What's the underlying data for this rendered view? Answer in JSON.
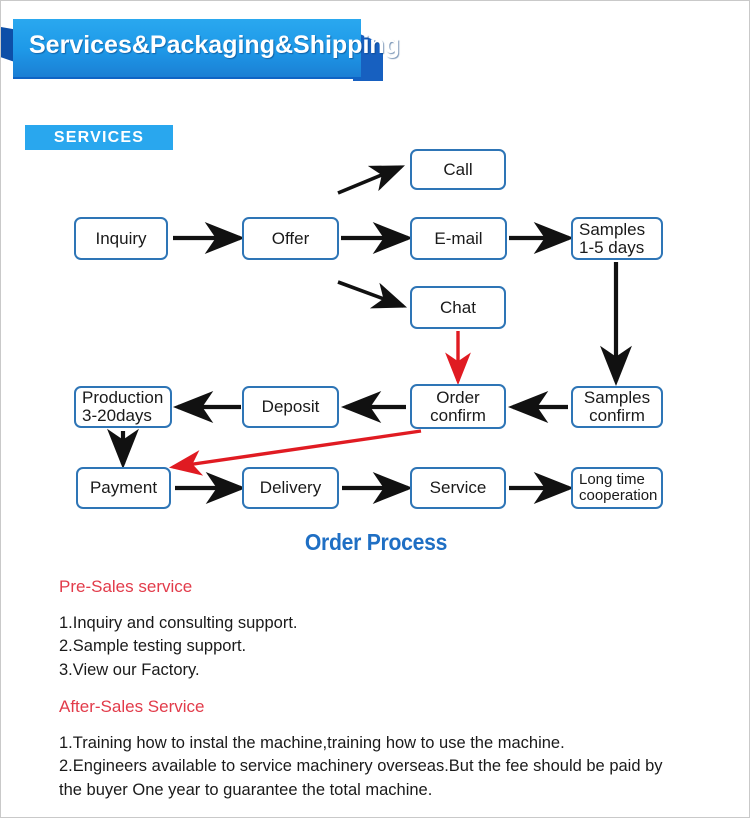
{
  "banner": {
    "title": "Services&Packaging&Shipping",
    "colors": {
      "light": "#29a7ee",
      "mid": "#1e99e8",
      "dark": "#1760c0",
      "fold": "#0d4fa8"
    }
  },
  "services_tag": {
    "label": "SERVICES",
    "bg": "#29a7ee",
    "text_color": "#ffffff"
  },
  "diagram": {
    "caption": "Order Process",
    "caption_color": "#1f6fc4",
    "node_border_color": "#2e75b6",
    "arrow_colors": {
      "black": "#111111",
      "red": "#e01b22"
    },
    "nodes": [
      {
        "id": "inquiry",
        "label": "Inquiry"
      },
      {
        "id": "offer",
        "label": "Offer"
      },
      {
        "id": "call",
        "label": "Call"
      },
      {
        "id": "email",
        "label": "E-mail"
      },
      {
        "id": "chat",
        "label": "Chat"
      },
      {
        "id": "samples_days",
        "label": "Samples\n1-5 days"
      },
      {
        "id": "samples_confirm",
        "label": "Samples\nconfirm"
      },
      {
        "id": "order_confirm",
        "label": "Order\nconfirm"
      },
      {
        "id": "deposit",
        "label": "Deposit"
      },
      {
        "id": "production",
        "label": "Production\n3-20days"
      },
      {
        "id": "payment",
        "label": "Payment"
      },
      {
        "id": "delivery",
        "label": "Delivery"
      },
      {
        "id": "service",
        "label": "Service"
      },
      {
        "id": "long_time",
        "label": "Long time\ncooperation"
      }
    ]
  },
  "pre_sales": {
    "heading": "Pre-Sales service",
    "heading_color": "#e23b4a",
    "body": "1.Inquiry and consulting support.\n2.Sample testing support.\n3.View our Factory."
  },
  "after_sales": {
    "heading": "After-Sales Service",
    "heading_color": "#e23b4a",
    "body": "1.Training how to instal the machine,training how to use the machine.\n2.Engineers available to service machinery overseas.But the fee should be paid by the buyer One year to guarantee the total machine."
  }
}
